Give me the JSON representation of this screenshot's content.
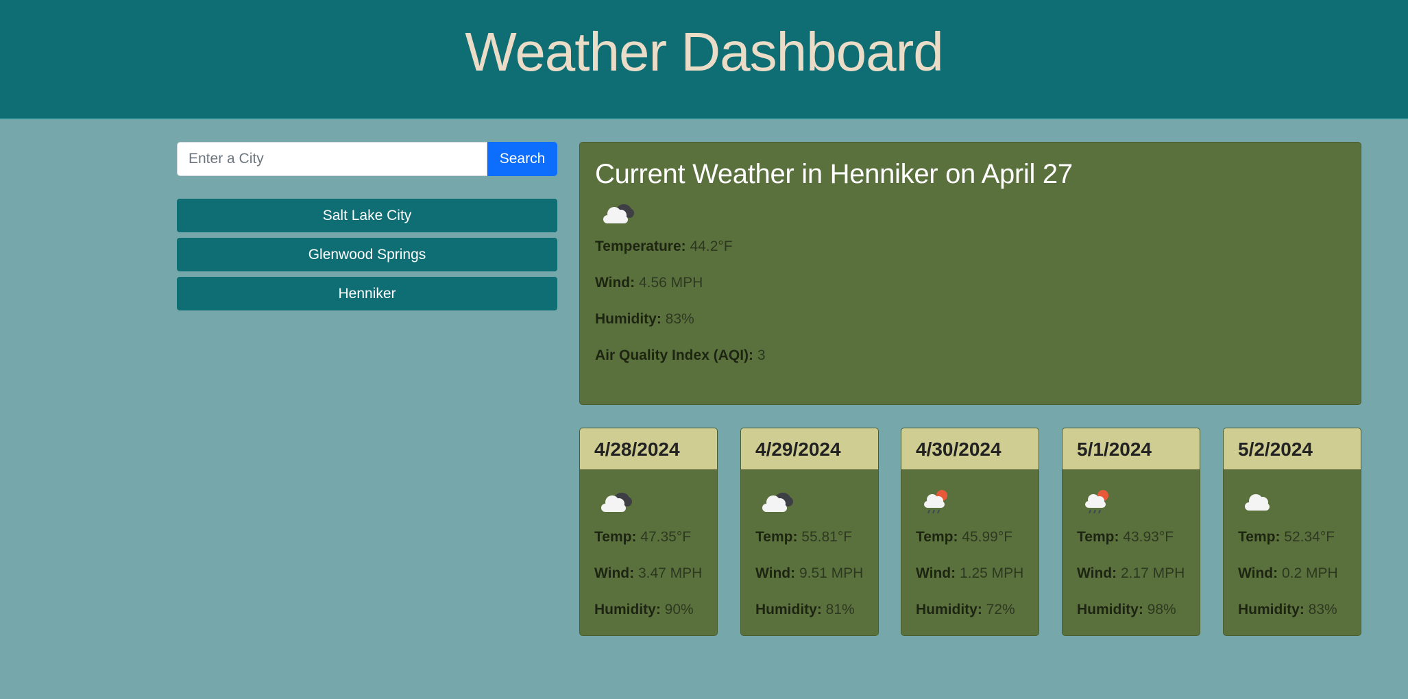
{
  "header": {
    "title": "Weather Dashboard"
  },
  "search": {
    "placeholder": "Enter a City",
    "value": "",
    "button_label": "Search"
  },
  "history": [
    {
      "label": "Salt Lake City"
    },
    {
      "label": "Glenwood Springs"
    },
    {
      "label": "Henniker"
    }
  ],
  "current": {
    "title": "Current Weather in Henniker on April 27",
    "icon": "cloudy-icon",
    "temperature_label": "Temperature:",
    "temperature": "44.2°F",
    "wind_label": "Wind:",
    "wind": "4.56 MPH",
    "humidity_label": "Humidity:",
    "humidity": "83%",
    "aqi_label": "Air Quality Index (AQI):",
    "aqi": "3"
  },
  "forecast_labels": {
    "temp": "Temp:",
    "wind": "Wind:",
    "humidity": "Humidity:"
  },
  "forecast": [
    {
      "date": "4/28/2024",
      "icon": "cloudy-icon",
      "temp": "47.35°F",
      "wind": "3.47 MPH",
      "humidity": "90%"
    },
    {
      "date": "4/29/2024",
      "icon": "cloudy-icon",
      "temp": "55.81°F",
      "wind": "9.51 MPH",
      "humidity": "81%"
    },
    {
      "date": "4/30/2024",
      "icon": "sun-rain-icon",
      "temp": "45.99°F",
      "wind": "1.25 MPH",
      "humidity": "72%"
    },
    {
      "date": "5/1/2024",
      "icon": "sun-rain-icon",
      "temp": "43.93°F",
      "wind": "2.17 MPH",
      "humidity": "98%"
    },
    {
      "date": "5/2/2024",
      "icon": "cloud-icon",
      "temp": "52.34°F",
      "wind": "0.2 MPH",
      "humidity": "83%"
    }
  ],
  "colors": {
    "header_bg": "#0f6e74",
    "page_bg": "#76a7ab",
    "title_color": "#ebdcc7",
    "card_bg": "#5b713d",
    "card_head_bg": "#cfcd91",
    "search_button": "#0d6efd"
  }
}
